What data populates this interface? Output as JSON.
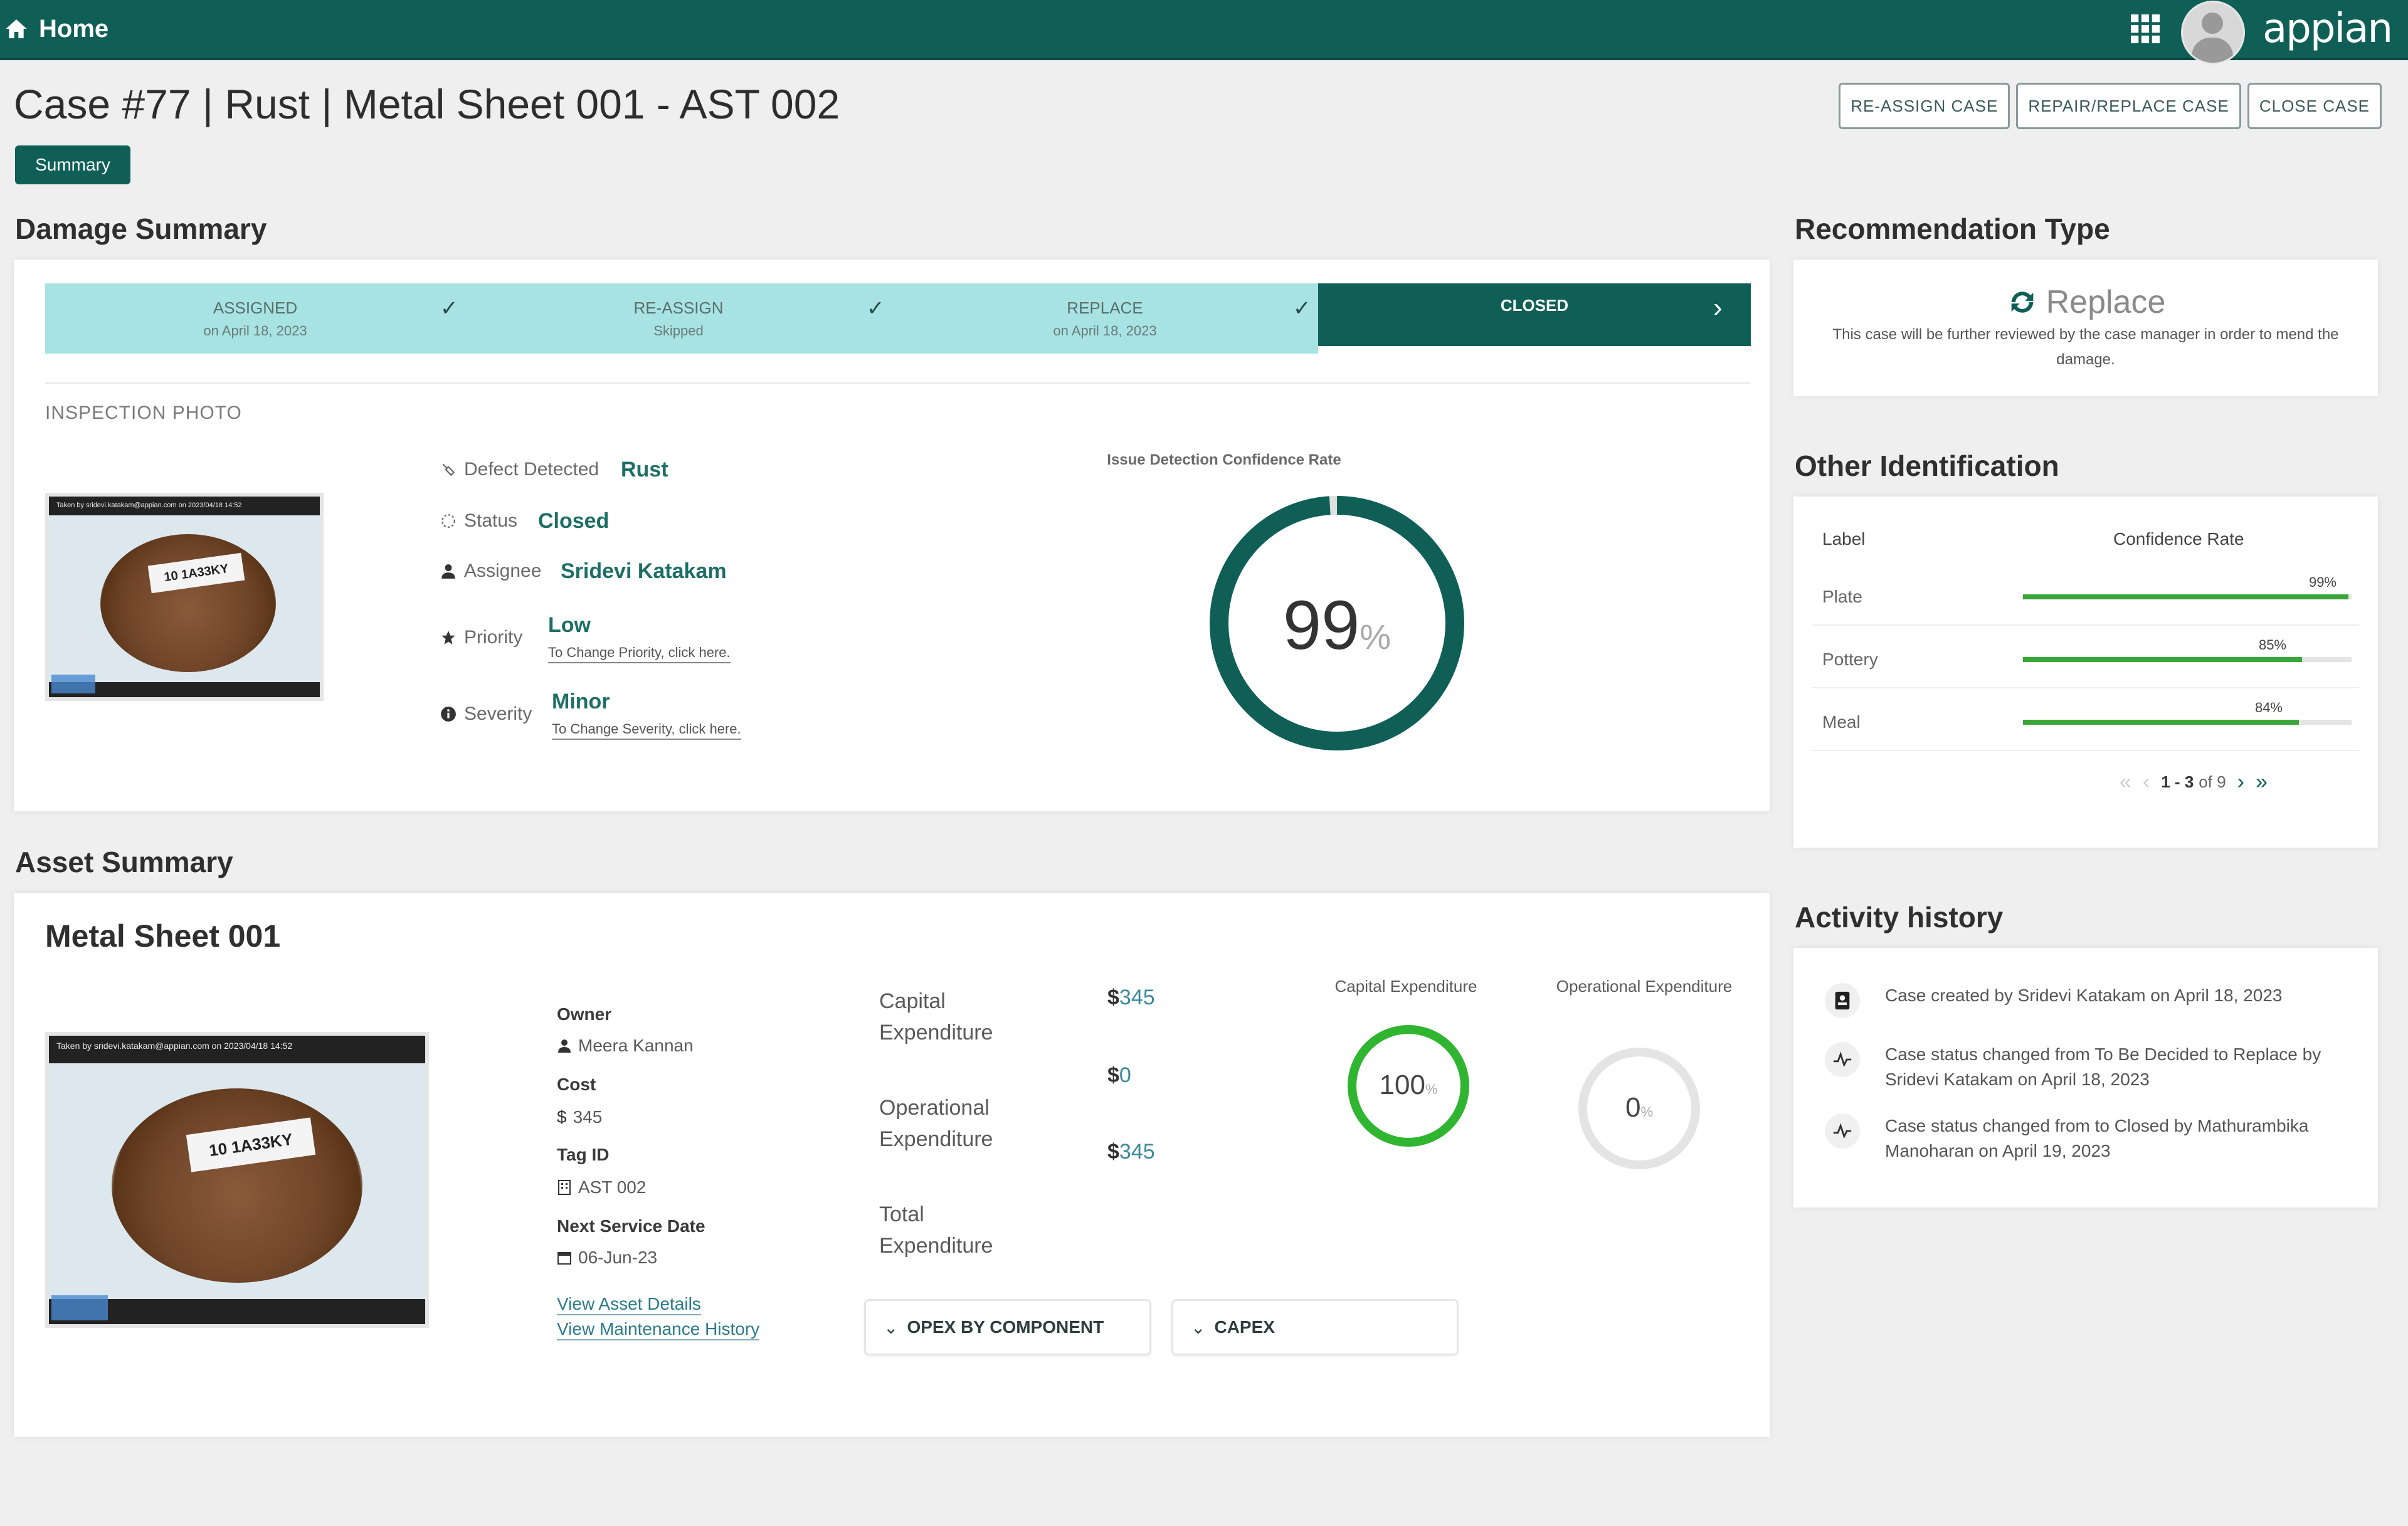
{
  "topbar": {
    "home_label": "Home",
    "logo": "appian",
    "apps_icon": "grid-icon",
    "avatar": "user-avatar"
  },
  "header": {
    "title": "Case #77 | Rust | Metal Sheet 001 - AST 002",
    "tab": "Summary",
    "buttons": [
      "RE-ASSIGN CASE",
      "REPAIR/REPLACE CASE",
      "CLOSE CASE"
    ]
  },
  "damage": {
    "title": "Damage Summary",
    "milestones": [
      {
        "label": "ASSIGNED",
        "sub": "on April 18, 2023"
      },
      {
        "label": "RE-ASSIGN",
        "sub": "Skipped"
      },
      {
        "label": "REPLACE",
        "sub": "on April 18, 2023"
      },
      {
        "label": "CLOSED",
        "sub": ""
      }
    ],
    "milestone_check": "✓",
    "milestone_arrow": "›",
    "photo_label": "INSPECTION PHOTO",
    "photo_tag": "10 1A33KY",
    "photo_caption": "Taken by sridevi.katakam@appian.com on 2023/04/18 14:52",
    "fields": {
      "defect_label": "Defect Detected",
      "defect_value": "Rust",
      "status_label": "Status",
      "status_value": "Closed",
      "assignee_label": "Assignee",
      "assignee_value": "Sridevi Katakam",
      "priority_label": "Priority",
      "priority_value": "Low",
      "priority_link": "To Change Priority, click here.",
      "severity_label": "Severity",
      "severity_value": "Minor",
      "severity_link": "To Change Severity, click here."
    },
    "gauge": {
      "title": "Issue Detection Confidence Rate",
      "value": 99,
      "value_text": "99",
      "unit": "%"
    }
  },
  "recommendation": {
    "title": "Recommendation Type",
    "type": "Replace",
    "desc": "This case will be further reviewed by the case manager in order to mend the damage."
  },
  "other_id": {
    "title": "Other Identification",
    "col_label": "Label",
    "col_rate": "Confidence Rate",
    "rows": [
      {
        "label": "Plate",
        "rate_text": "99%",
        "rate": 0.99
      },
      {
        "label": "Pottery",
        "rate_text": "85%",
        "rate": 0.85
      },
      {
        "label": "Meal",
        "rate_text": "84%",
        "rate": 0.84
      }
    ],
    "pager": "1 - 3",
    "pager_of": "of 9"
  },
  "activity": {
    "title": "Activity history",
    "items": [
      {
        "text": "Case created by Sridevi Katakam on April 18, 2023",
        "icon": "id-card-icon"
      },
      {
        "text": "Case status changed from To Be Decided to Replace by Sridevi Katakam on April 18, 2023",
        "icon": "status-change-icon"
      },
      {
        "text": "Case status changed from  to Closed by Mathurambika Manoharan on April 19, 2023",
        "icon": "status-change-icon"
      }
    ]
  },
  "asset": {
    "section_title": "Asset Summary",
    "name": "Metal Sheet 001",
    "photo_caption": "Taken by sridevi.katakam@appian.com on 2023/04/18 14:52",
    "photo_tag": "10 1A33KY",
    "owner_label": "Owner",
    "owner_value": "Meera Kannan",
    "cost_label": "Cost",
    "cost_value": "345",
    "tag_label": "Tag ID",
    "tag_value": "AST 002",
    "service_label": "Next Service Date",
    "service_value": "06-Jun-23",
    "link_details": "View Asset Details",
    "link_history": "View Maintenance History",
    "capex_label": "Capital Expenditure",
    "opex_label": "Operational Expenditure",
    "total_label": "Total Expenditure",
    "currency": "$",
    "capex_value": "345",
    "opex_value": "0",
    "total_value": "345",
    "capex_ring_title": "Capital Expenditure",
    "capex_ring_value": "100",
    "capex_ring_fill": 1.0,
    "opex_ring_title": "Operational Expenditure",
    "opex_ring_value": "0",
    "opex_ring_fill": 0,
    "ring_unit": "%",
    "accordion_opex": "OPEX BY COMPONENT",
    "accordion_capex": "CAPEX",
    "accordion_chevron": "⌄"
  },
  "colors": {
    "brand": "#0f5f57",
    "milestone": "#a8e3e3",
    "green": "#2fb52f",
    "link": "#1d6f66"
  }
}
